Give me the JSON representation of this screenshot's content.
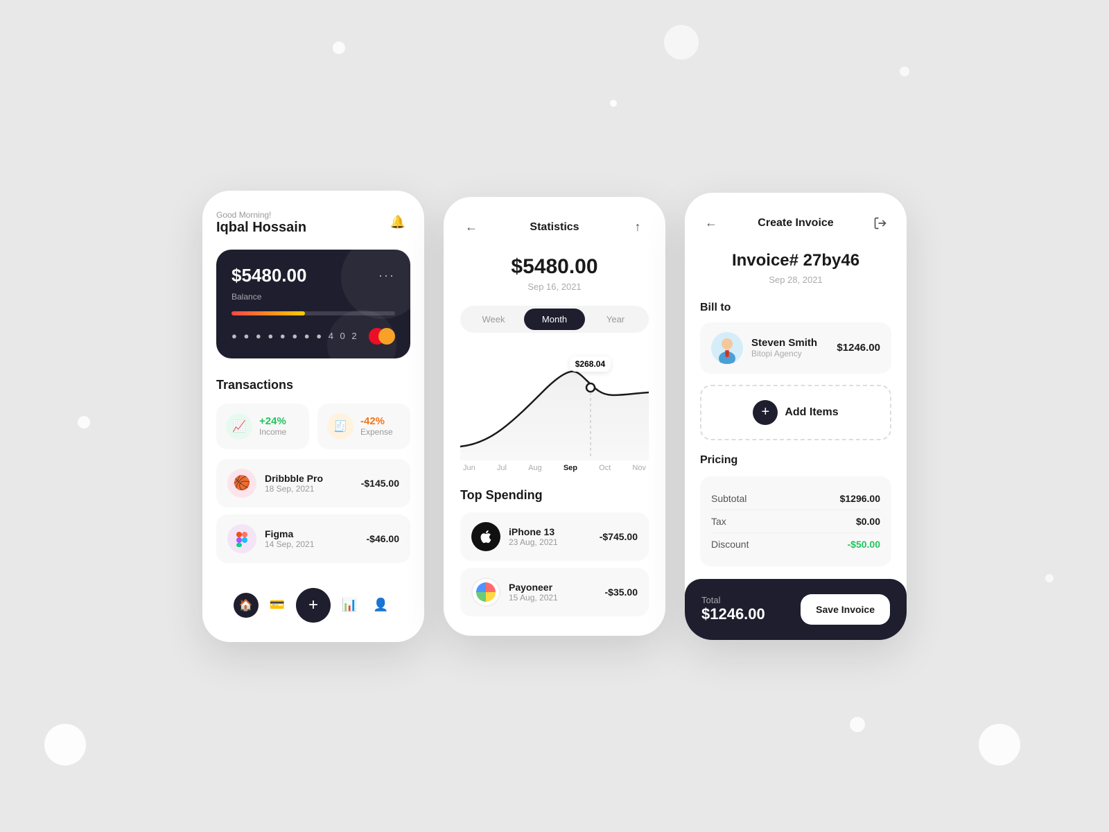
{
  "background": {
    "color": "#e4e4e4"
  },
  "screen1": {
    "greeting": "Good Morning!",
    "name": "Iqbal Hossain",
    "card": {
      "balance": "$5480.00",
      "balance_label": "Balance",
      "card_number": "● ● ● ●  ● ● ● ●  4 0 2",
      "three_dots": "···"
    },
    "transactions_title": "Transactions",
    "income": {
      "percent": "+24%",
      "label": "Income"
    },
    "expense": {
      "percent": "-42%",
      "label": "Expense"
    },
    "items": [
      {
        "name": "Dribbble Pro",
        "date": "18 Sep, 2021",
        "amount": "-$145.00"
      },
      {
        "name": "Figma",
        "date": "14 Sep, 2021",
        "amount": "-$46.00"
      }
    ]
  },
  "screen2": {
    "title": "Statistics",
    "amount": "$5480.00",
    "date": "Sep 16, 2021",
    "tabs": [
      "Week",
      "Month",
      "Year"
    ],
    "active_tab": "Month",
    "chart_tooltip": "$268.04",
    "x_axis": [
      "Jun",
      "Jul",
      "Aug",
      "Sep",
      "Oct",
      "Nov"
    ],
    "active_x": "Sep",
    "top_spending_title": "Top Spending",
    "items": [
      {
        "name": "iPhone 13",
        "date": "23 Aug, 2021",
        "amount": "-$745.00"
      },
      {
        "name": "Payoneer",
        "date": "15 Aug, 2021",
        "amount": "-$35.00"
      }
    ]
  },
  "screen3": {
    "title": "Create Invoice",
    "invoice_number": "Invoice# 27by46",
    "invoice_date": "Sep 28, 2021",
    "bill_to_label": "Bill to",
    "client": {
      "name": "Steven Smith",
      "company": "Bitopi Agency",
      "amount": "$1246.00"
    },
    "add_items_label": "Add Items",
    "pricing_label": "Pricing",
    "pricing": {
      "subtotal_label": "Subtotal",
      "subtotal_value": "$1296.00",
      "tax_label": "Tax",
      "tax_value": "$0.00",
      "discount_label": "Discount",
      "discount_value": "-$50.00"
    },
    "total_label": "Total",
    "total_amount": "$1246.00",
    "save_button": "Save Invoice"
  }
}
